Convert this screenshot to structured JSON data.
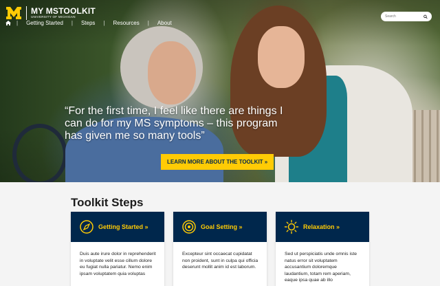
{
  "brand": {
    "title": "MY MSTOOLKIT",
    "subtitle": "UNIVERSITY OF MICHIGAN"
  },
  "nav": {
    "items": [
      "Getting Started",
      "Steps",
      "Resources",
      "About"
    ]
  },
  "search": {
    "placeholder": "Search"
  },
  "hero": {
    "quote": "“For the first time, I feel like there are things I can do for my MS symptoms – this program has given me so many tools”",
    "cta_label": "LEARN MORE ABOUT THE TOOLKIT »"
  },
  "steps": {
    "title": "Toolkit Steps",
    "cards": [
      {
        "title": "Getting Started »",
        "icon": "compass-icon",
        "body": "Duis aute irure dolor in reprehenderit in voluptate velit esse cillum dolore eu fugiat nulla pariatur. Nemo enim ipsam voluptatem quia voluptas"
      },
      {
        "title": "Goal Setting »",
        "icon": "target-icon",
        "body": "Excepteur sint occaecat cupidatat non proident, sunt in culpa qui officia deserunt mollit anim id est laborum."
      },
      {
        "title": "Relaxation »",
        "icon": "sun-icon",
        "body": "Sed ut perspiciatis unde omnis iste natus error sit voluptatem accusantium doloremque laudantium, totam rem aperiam, eaque ipsa quae ab illo"
      }
    ]
  },
  "colors": {
    "navy": "#00274c",
    "maize": "#ffcb05"
  }
}
